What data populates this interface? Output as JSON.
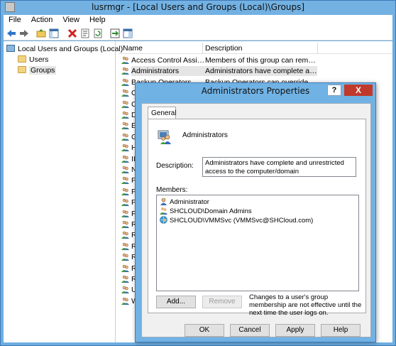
{
  "window": {
    "title": "lusrmgr - [Local Users and Groups (Local)\\Groups]"
  },
  "menu": [
    "File",
    "Action",
    "View",
    "Help"
  ],
  "toolbar": [
    "back-icon",
    "forward-icon",
    "up-folder-icon",
    "show-hide-tree-icon",
    "delete-icon",
    "properties-icon",
    "refresh-icon",
    "export-list-icon",
    "help-pane-icon"
  ],
  "tree": {
    "root": "Local Users and Groups (Local)",
    "items": [
      "Users",
      "Groups"
    ]
  },
  "list": {
    "columns": [
      "Name",
      "Description"
    ],
    "rows": [
      {
        "name": "Access Control Assist...",
        "desc": "Members of this group can remot..."
      },
      {
        "name": "Administrators",
        "desc": "Administrators have complete an..."
      },
      {
        "name": "Backup Operators",
        "desc": "Backup Operators can override se..."
      },
      {
        "name": "Ce",
        "desc": ""
      },
      {
        "name": "Cry",
        "desc": ""
      },
      {
        "name": "Dis",
        "desc": ""
      },
      {
        "name": "Eve",
        "desc": ""
      },
      {
        "name": "Gu",
        "desc": ""
      },
      {
        "name": "Hy",
        "desc": ""
      },
      {
        "name": "IIS",
        "desc": ""
      },
      {
        "name": "Ne",
        "desc": ""
      },
      {
        "name": "Pe",
        "desc": ""
      },
      {
        "name": "Pe",
        "desc": ""
      },
      {
        "name": "Po",
        "desc": ""
      },
      {
        "name": "Pri",
        "desc": ""
      },
      {
        "name": "RD",
        "desc": ""
      },
      {
        "name": "RD",
        "desc": ""
      },
      {
        "name": "RD",
        "desc": ""
      },
      {
        "name": "Re",
        "desc": ""
      },
      {
        "name": "Re",
        "desc": ""
      },
      {
        "name": "Re",
        "desc": ""
      },
      {
        "name": "Us",
        "desc": ""
      },
      {
        "name": "Wi",
        "desc": ""
      }
    ]
  },
  "dialog": {
    "title": "Administrators Properties",
    "help": "?",
    "close": "X",
    "tab": "General",
    "group_name": "Administrators",
    "description_label": "Description:",
    "description": "Administrators have complete and unrestricted access to the computer/domain",
    "members_label": "Members:",
    "members": [
      "Administrator",
      "SHCLOUD\\Domain Admins",
      "SHCLOUD\\VMMSvc (VMMSvc@SHCloud.com)"
    ],
    "add": "Add...",
    "remove": "Remove",
    "note": "Changes to a user's group membership are not effective until the next time the user logs on.",
    "ok": "OK",
    "cancel": "Cancel",
    "apply": "Apply",
    "help_btn": "Help"
  }
}
